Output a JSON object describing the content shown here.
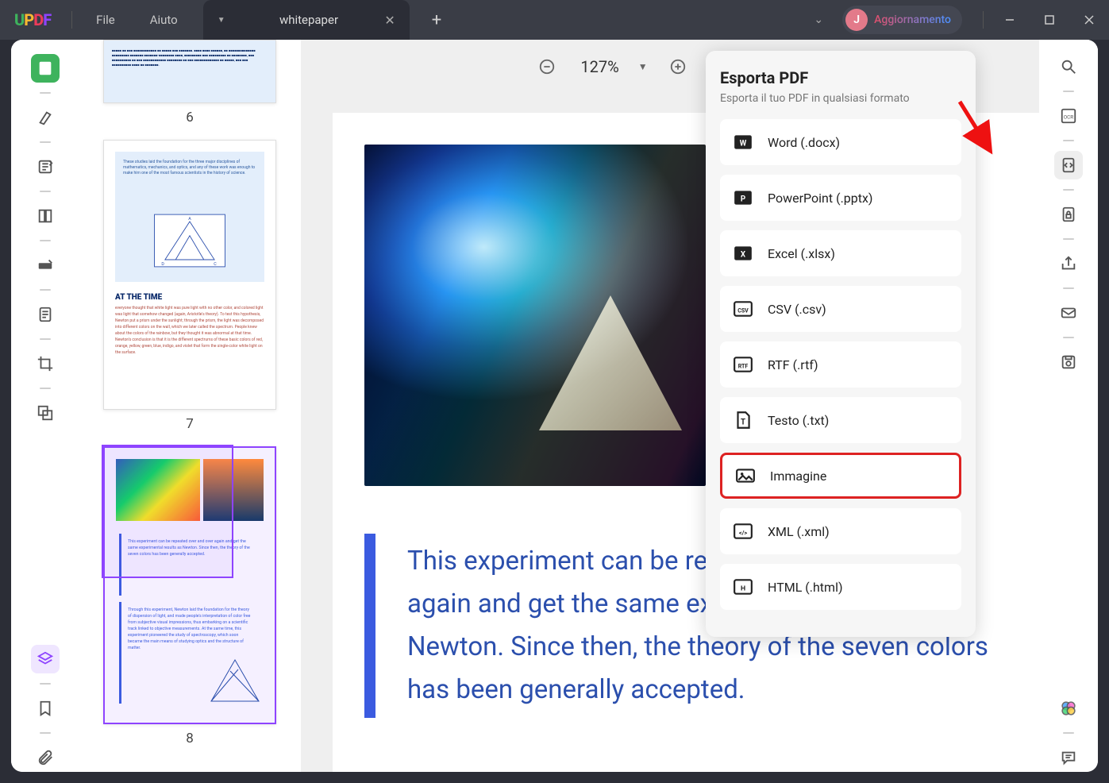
{
  "app": {
    "logo_letters": [
      "U",
      "P",
      "D",
      "F"
    ]
  },
  "titlebar": {
    "menu_file": "File",
    "menu_help": "Aiuto",
    "tab_title": "whitepaper",
    "user_initial": "J",
    "user_update": "Aggiornamento"
  },
  "toolbar": {
    "zoom": "127%"
  },
  "thumbnails": {
    "pages": [
      {
        "num": "6"
      },
      {
        "num": "7",
        "heading": "AT THE TIME"
      },
      {
        "num": "8",
        "selected": true
      }
    ]
  },
  "document": {
    "quote": "This experiment can be repeated over and over again and get the same experimental results as Newton. Since then, the theory of the seven colors has been generally accepted."
  },
  "export_panel": {
    "title": "Esporta PDF",
    "subtitle": "Esporta il tuo PDF in qualsiasi formato",
    "items": [
      {
        "label": "Word (.docx)",
        "icon": "word"
      },
      {
        "label": "PowerPoint (.pptx)",
        "icon": "ppt"
      },
      {
        "label": "Excel (.xlsx)",
        "icon": "xls"
      },
      {
        "label": "CSV (.csv)",
        "icon": "csv"
      },
      {
        "label": "RTF (.rtf)",
        "icon": "rtf"
      },
      {
        "label": "Testo (.txt)",
        "icon": "txt"
      },
      {
        "label": "Immagine",
        "icon": "img",
        "highlight": true
      },
      {
        "label": "XML (.xml)",
        "icon": "xml"
      },
      {
        "label": "HTML (.html)",
        "icon": "html"
      }
    ]
  },
  "annotations": {
    "highlighted_export_index": 6
  }
}
